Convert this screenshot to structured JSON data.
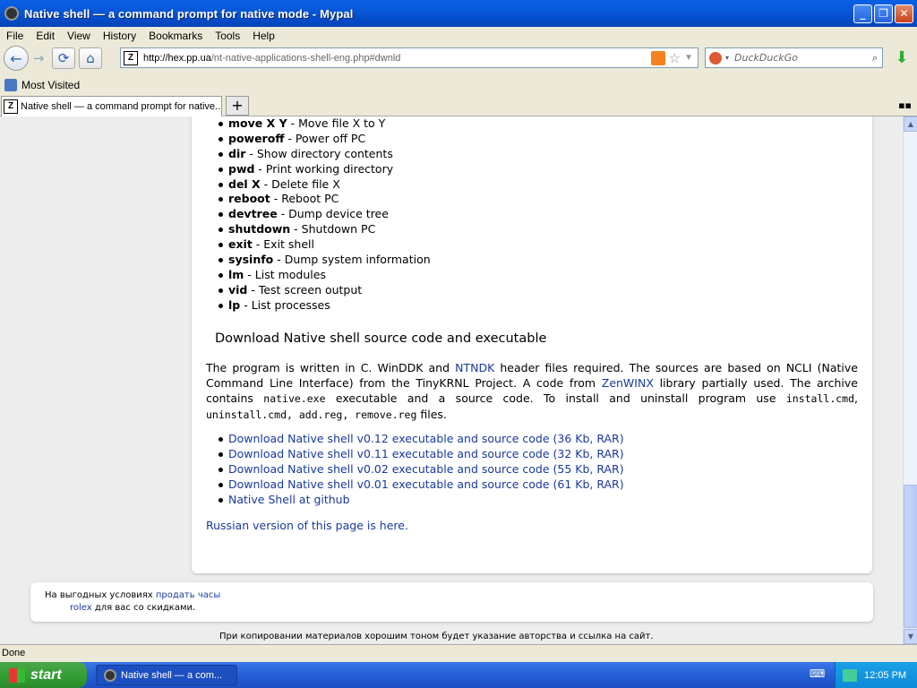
{
  "window": {
    "title": "Native shell — a command prompt for native mode - Mypal"
  },
  "menu": [
    "File",
    "Edit",
    "View",
    "History",
    "Bookmarks",
    "Tools",
    "Help"
  ],
  "nav": {
    "url_host": "http://hex.pp.ua",
    "url_path": "/nt-native-applications-shell-eng.php#dwnld",
    "search_placeholder": "DuckDuckGo",
    "favicon_text": "Z"
  },
  "bookmarks": {
    "most_visited": "Most Visited"
  },
  "tab": {
    "title": "Native shell — a command prompt for native..."
  },
  "commands": [
    {
      "cmd": "move X Y",
      "desc": " - Move file X to Y"
    },
    {
      "cmd": "poweroff",
      "desc": " - Power off PC"
    },
    {
      "cmd": "dir",
      "desc": " - Show directory contents"
    },
    {
      "cmd": "pwd",
      "desc": " - Print working directory"
    },
    {
      "cmd": "del X",
      "desc": " - Delete file X"
    },
    {
      "cmd": "reboot",
      "desc": " - Reboot PC"
    },
    {
      "cmd": "devtree",
      "desc": " - Dump device tree"
    },
    {
      "cmd": "shutdown",
      "desc": " - Shutdown PC"
    },
    {
      "cmd": "exit",
      "desc": " - Exit shell"
    },
    {
      "cmd": "sysinfo",
      "desc": " - Dump system information"
    },
    {
      "cmd": "lm",
      "desc": " - List modules"
    },
    {
      "cmd": "vid",
      "desc": " - Test screen output"
    },
    {
      "cmd": "lp",
      "desc": " - List processes"
    }
  ],
  "download": {
    "heading": "Download Native shell source code and executable",
    "p1": "The program is written in C. WinDDK and ",
    "ntndk": "NTNDK",
    "p2": " header files required. The sources are based on NCLI (Native Command Line Interface) from the TinyKRNL Project. A code from ",
    "zenwinx": "ZenWINX",
    "p3": " library partially used. The archive contains ",
    "native_exe": "native.exe",
    "p4": " executable and a source code. To install and uninstall program use ",
    "install_cmd": "install.cmd",
    "p5": ", ",
    "uninstall_cmd": "uninstall.cmd, add.reg, remove.reg",
    "p6": " files.",
    "links": [
      "Download Native shell v0.12 executable and source code (36 Kb, RAR)",
      "Download Native shell v0.11 executable and source code (32 Kb, RAR)",
      "Download Native shell v0.02 executable and source code (55 Kb, RAR)",
      "Download Native shell v0.01 executable and source code (61 Kb, RAR)",
      "Native Shell at github"
    ],
    "russian": "Russian version of this page is here."
  },
  "ad": {
    "t1": "На выгодных условиях ",
    "link1": "продать часы",
    "link2": "rolex",
    "t2": " для вас со скидками."
  },
  "footer": "При копировании материалов хорошим тоном будет указание авторства и ссылка на сайт.",
  "status": "Done",
  "taskbar": {
    "start": "start",
    "task": "Native shell — a com...",
    "clock": "12:05 PM"
  }
}
